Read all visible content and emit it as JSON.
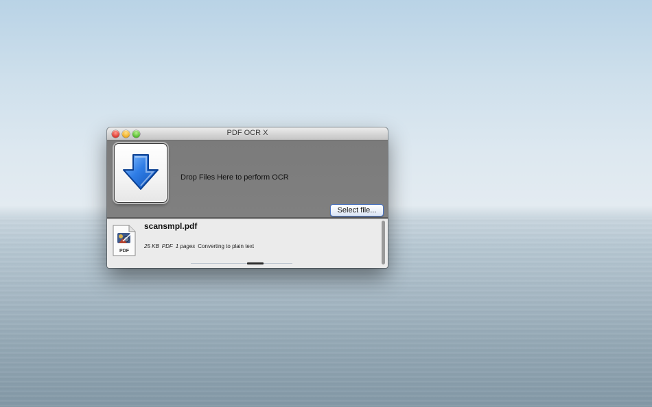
{
  "window": {
    "title": "PDF OCR X"
  },
  "dropzone": {
    "icon": "download-arrow-icon",
    "text": "Drop Files Here to perform OCR",
    "select_button": "Select file..."
  },
  "files": [
    {
      "name": "scansmpl.pdf",
      "icon": "pdf-document-icon",
      "icon_label": "PDF",
      "size": "25 KB",
      "type": "PDF",
      "pages": "1 pages",
      "status": "Converting to plain text"
    }
  ],
  "colors": {
    "arrow_blue": "#2f7de6",
    "button_focus_border": "#4b74c2",
    "dropzone_bg": "#7e7e7e",
    "list_bg": "#ebebeb"
  }
}
